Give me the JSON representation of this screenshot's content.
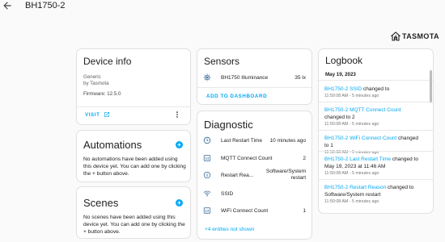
{
  "header": {
    "title": "BH1750-2"
  },
  "brand": {
    "name": "TASMOTA",
    "icon": "tasmota-house-icon"
  },
  "device_info": {
    "title": "Device info",
    "model": "Generic",
    "manufacturer": "by Tasmota",
    "firmware": "Firmware: 12.5.0",
    "visit_label": "VISIT"
  },
  "automations": {
    "title": "Automations",
    "empty_text": "No automations have been added using this device yet. You can add one by clicking the + button above."
  },
  "scenes": {
    "title": "Scenes",
    "empty_text": "No scenes have been added using this device yet. You can add one by clicking the + button above."
  },
  "sensors": {
    "title": "Sensors",
    "items": [
      {
        "icon": "brightness-icon",
        "label": "BH1750 Illuminance",
        "value": "35 lx"
      }
    ],
    "add_label": "ADD TO DASHBOARD"
  },
  "diagnostic": {
    "title": "Diagnostic",
    "items": [
      {
        "icon": "clock-icon",
        "label": "Last Restart Time",
        "value": "10 minutes ago"
      },
      {
        "icon": "counter-icon",
        "label": "MQTT Connect Count",
        "value": "2"
      },
      {
        "icon": "info-icon",
        "label": "Restart Rea...",
        "value": "Software/System restart"
      },
      {
        "icon": "wifi-icon",
        "label": "SSID",
        "value": ""
      },
      {
        "icon": "counter-icon",
        "label": "WiFi Connect Count",
        "value": "1"
      }
    ],
    "more_label": "+4 entities not shown"
  },
  "logbook": {
    "title": "Logbook",
    "date": "May 19, 2023",
    "entries": [
      {
        "entity": "BH1750-2 SSID",
        "text": " changed to",
        "time": "11:50:08 AM - 5 minutes ago"
      },
      {
        "entity": "BH1750-2 MQTT Connect Count",
        "text": " changed to 2",
        "time": "11:50:08 AM - 5 minutes ago"
      },
      {
        "entity": "BH1750-2 WiFi Connect Count",
        "text": " changed to 1",
        "time": "11:50:08 AM - 5 minutes ago"
      },
      {
        "entity": "BH1750-2 Last Restart Time",
        "text": " changed to May 19, 2023 at 11:46 AM",
        "time": "11:50:08 AM - 5 minutes ago"
      },
      {
        "entity": "BH1750-2 Restart Reason",
        "text": " changed to Software/System restart",
        "time": "11:50:08 AM - 5 minutes ago"
      }
    ]
  },
  "colors": {
    "accent": "#03a9f4",
    "icon": "#44739e",
    "background": "#fafafa"
  }
}
